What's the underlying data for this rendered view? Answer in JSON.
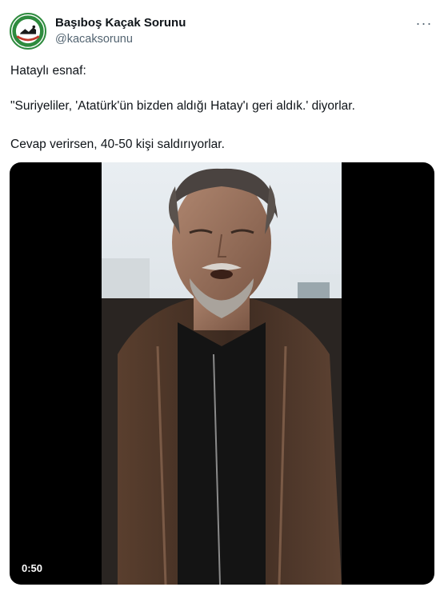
{
  "author": {
    "name": "Başıboş Kaçak Sorunu",
    "handle": "@kacaksorunu",
    "avatar_icon": "green-circular-logo-icon"
  },
  "more_icon": "ellipsis-icon",
  "tweet": {
    "line1": "Hataylı esnaf:",
    "line2": "\"Suriyeliler, 'Atatürk'ün bizden aldığı Hatay'ı geri aldık.' diyorlar.",
    "line3": "Cevap verirsen, 40-50 kişi saldırıyorlar."
  },
  "video": {
    "duration": "0:50"
  },
  "colors": {
    "text": "#0f1419",
    "secondary": "#536471",
    "avatar_green": "#2e8b3e"
  }
}
